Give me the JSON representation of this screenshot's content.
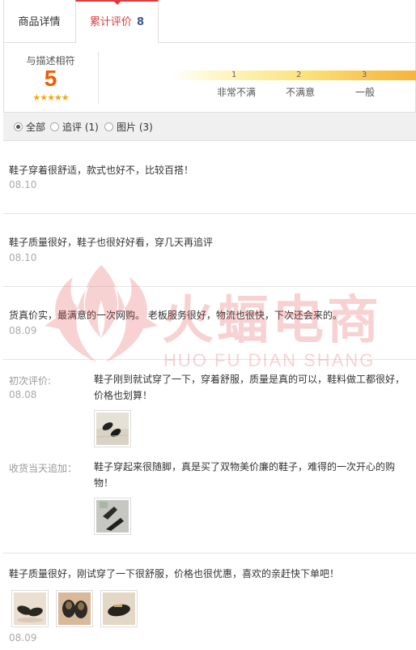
{
  "tabs": [
    {
      "label": "商品详情",
      "count": ""
    },
    {
      "label": "累计评价",
      "count": "8"
    }
  ],
  "rating": {
    "label": "与描述相符",
    "score": "5",
    "stars": "★★★★★",
    "ticks": [
      "1",
      "2",
      "3"
    ],
    "levels": [
      "非常不满",
      "不满意",
      "一般"
    ]
  },
  "filter": {
    "options": [
      "全部",
      "追评 (1)",
      "图片 (3)"
    ],
    "selected": 0
  },
  "reviews": [
    {
      "text": "鞋子穿着很舒适，款式也好不，比较百搭！",
      "date": "08.10"
    },
    {
      "text": "鞋子质量很好，鞋子也很好好看，穿几天再追评",
      "date": "08.10"
    },
    {
      "text": "货真价实，最满意的一次网购。 老板服务很好，物流也很快，下次还会来的。",
      "date": "08.09"
    },
    {
      "initial_label": "初次评价:",
      "initial_date": "08.08",
      "initial_text": "鞋子刚到就试穿了一下，穿着舒服，质量是真的可以，鞋料做工都很好，价格也划算！",
      "append_label": "收货当天追加：",
      "append_text": "鞋子穿起来很随脚，真是买了双物美价廉的鞋子，难得的一次开心的购物！"
    },
    {
      "text": "鞋子质量很好，刚试穿了一下很舒服，价格也很优惠，喜欢的亲赶快下单吧！",
      "date": "08.09"
    }
  ],
  "watermark": {
    "cn": "火蝠电商",
    "en": "HUO FU DIAN SHANG"
  },
  "colors": {
    "accent": "#e4393c",
    "score": "#f25c05",
    "star": "#f7a900",
    "count": "#3b5998"
  }
}
